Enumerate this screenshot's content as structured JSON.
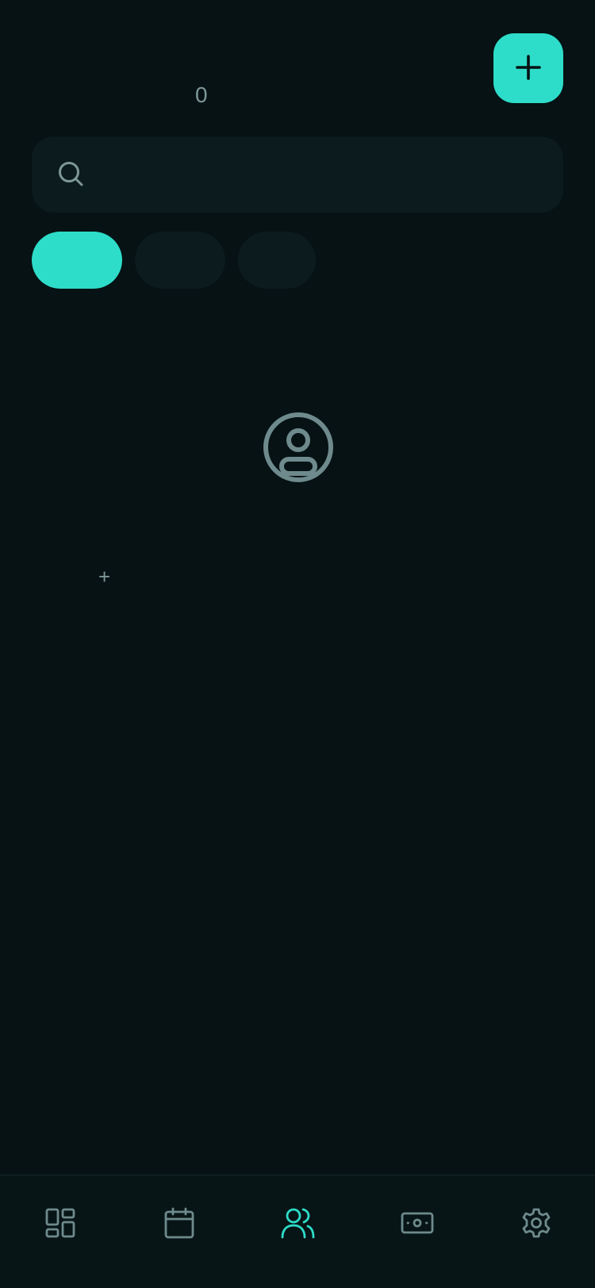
{
  "header": {
    "count": "0",
    "add_icon": "plus-icon"
  },
  "search": {
    "icon": "search-icon",
    "value": "",
    "placeholder": ""
  },
  "filters": [
    {
      "label": "",
      "active": true
    },
    {
      "label": "",
      "active": false
    },
    {
      "label": "",
      "active": false
    }
  ],
  "empty_state": {
    "icon": "user-circle-icon",
    "hint": "+"
  },
  "tabbar": {
    "items": [
      {
        "icon": "dashboard-icon",
        "active": false
      },
      {
        "icon": "calendar-icon",
        "active": false
      },
      {
        "icon": "users-icon",
        "active": true
      },
      {
        "icon": "banknote-icon",
        "active": false
      },
      {
        "icon": "gear-icon",
        "active": false
      }
    ]
  },
  "colors": {
    "background": "#061214",
    "surface": "#0c1b1e",
    "accent": "#2dddc9",
    "muted": "#7e9799"
  }
}
